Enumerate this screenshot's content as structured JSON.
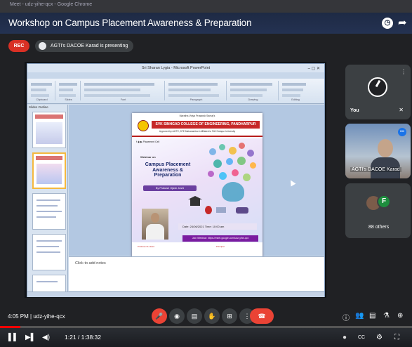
{
  "browser": {
    "tab_text": "Meet - udz-yihe-qcx - Google Chrome"
  },
  "video": {
    "title": "Workshop on Campus Placement Awareness & Preparation",
    "clock_icon": "clock-icon",
    "share_icon": "share-icon"
  },
  "meet_header": {
    "rec_label": "REC",
    "presenting_text": "AGTI's DACOE Karad is presenting"
  },
  "ppt": {
    "window_title": "Sri Sharan Lygia - Microsoft PowerPoint",
    "window_controls": "–  ▢  ✕",
    "ribbon_tabs": [
      "Home",
      "Insert",
      "Design",
      "Animations",
      "Slide Show",
      "Review",
      "View"
    ],
    "ribbon_groups": [
      "Clipboard",
      "Slides",
      "Font",
      "Paragraph",
      "Drawing",
      "Editing"
    ],
    "thumb_tabs": "Slides  Outline",
    "notes_placeholder": "Click to add notes"
  },
  "slide": {
    "top_small": "Maratha Vidya Prasarak Samaj's",
    "college": "SVK SINHGAD COLLEGE OF ENGINEERING, PANDHARPUR",
    "affiliation": "Approved by AICTE, DTE Maharashtra & Affiliated to PAH Solapur University",
    "social": "f ◉ ▶  Placement Cell",
    "webinar": "Webinar on",
    "topic": "Campus Placement Awareness & Preparation",
    "by": "By Prakash Ojash Joshi",
    "date": "Date: 24/06/2021     Time: 10:00 am",
    "footer_bar": "Join Webinar: https://meet.google.com/udz-yihe-qcx",
    "footer_left": "Professor & Head",
    "footer_right": "Principal"
  },
  "participants": {
    "you_label": "You",
    "presenter_label": "AGTI's DACOE Karad",
    "others_label": "88 others",
    "others_initial": "F",
    "mute_icon": "mic-off-icon"
  },
  "meet_bottom": {
    "time_and_code": "4:05 PM  |  udz-yihe-qcx",
    "controls": [
      "🎤",
      "◉",
      "▤",
      "✋",
      "⊞",
      "⋮"
    ],
    "end_call_icon": "☎",
    "right_icons": [
      "ⓘ",
      "👥",
      "▤",
      "⚗",
      "⊕"
    ]
  },
  "youtube": {
    "time": "1:21 / 1:38:32",
    "played_fraction": 0.05,
    "left_controls": [
      "▌▌",
      "▶▌",
      "◀)"
    ],
    "right_controls": [
      "●",
      "CC",
      "⚙",
      "⛶"
    ]
  }
}
